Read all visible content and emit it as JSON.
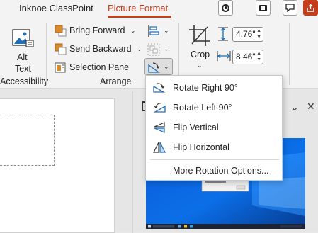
{
  "tabs": [
    {
      "label": "Inknoe ClassPoint"
    },
    {
      "label": "Picture Format",
      "active": true
    }
  ],
  "colors": {
    "accent": "#c43e1c",
    "icon_blue": "#1f6fb5",
    "icon_orange": "#d98b2b"
  },
  "ribbon": {
    "accessibility": {
      "button_label_line1": "Alt",
      "button_label_line2": "Text",
      "group_label": "Accessibility"
    },
    "arrange": {
      "bring_forward": "Bring Forward",
      "send_backward": "Send Backward",
      "selection_pane": "Selection Pane",
      "group_label": "Arrange"
    },
    "size": {
      "crop_label": "Crop",
      "height": "4.76\"",
      "width": "8.46\""
    }
  },
  "rotate_menu": {
    "items": [
      {
        "label": "Rotate Right 90°",
        "icon": "rotate-right-icon"
      },
      {
        "label": "Rotate Left 90°",
        "icon": "rotate-left-icon"
      },
      {
        "label": "Flip Vertical",
        "icon": "flip-vertical-icon"
      },
      {
        "label": "Flip Horizontal",
        "icon": "flip-horizontal-icon"
      }
    ],
    "more_options": "More Rotation Options..."
  }
}
